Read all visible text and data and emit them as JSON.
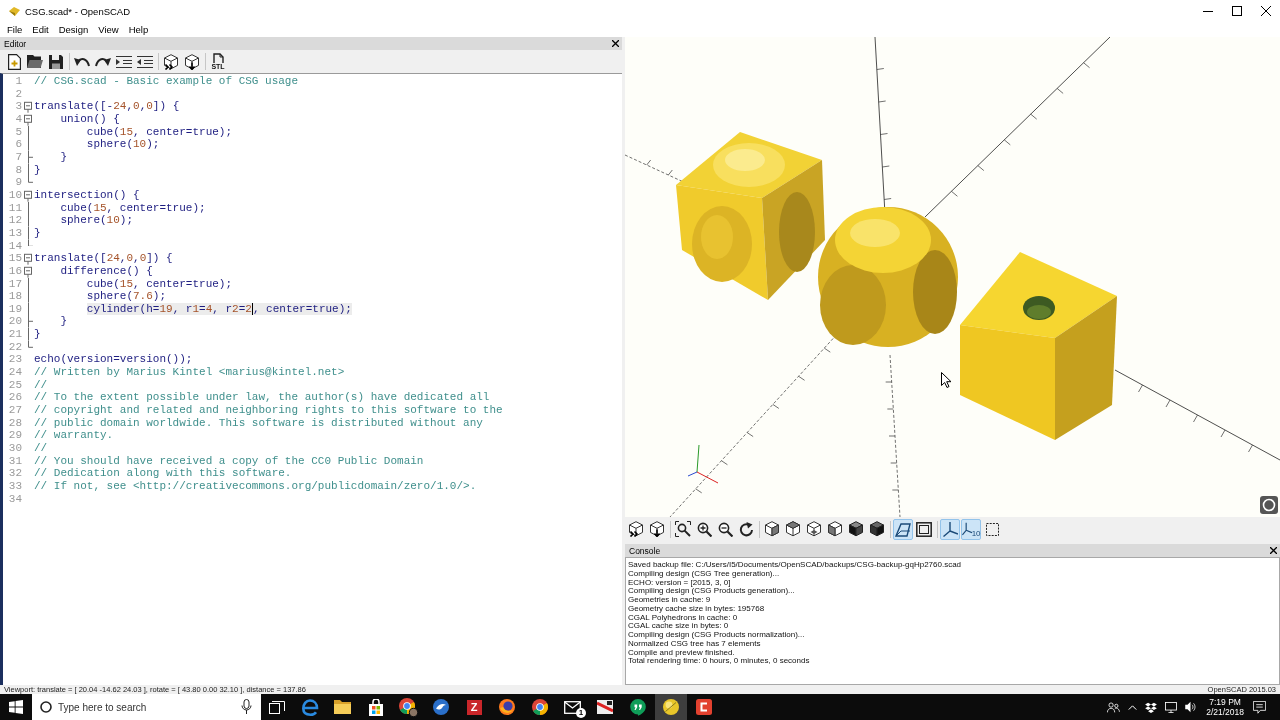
{
  "window": {
    "title": "CSG.scad* - OpenSCAD"
  },
  "menu": [
    "File",
    "Edit",
    "Design",
    "View",
    "Help"
  ],
  "editor": {
    "title": "Editor",
    "toolbar_groups": [
      [
        {
          "kind": "new"
        },
        {
          "kind": "open"
        },
        {
          "kind": "save"
        }
      ],
      [
        {
          "kind": "undo"
        },
        {
          "kind": "redo"
        },
        {
          "kind": "indent"
        },
        {
          "kind": "unindent"
        }
      ],
      [
        {
          "kind": "preview"
        },
        {
          "kind": "render"
        }
      ],
      [
        {
          "kind": "export-stl",
          "label": "STL"
        }
      ]
    ],
    "lines": [
      {
        "number": "1",
        "kind": "comment",
        "text": "// CSG.scad - Basic example of CSG usage",
        "selected": false
      },
      {
        "number": "2",
        "selected": false
      },
      {
        "number": "3",
        "kind": "code",
        "text": "translate([-24,0,0]) {",
        "fold": {
          "kind": "start"
        },
        "selected": false
      },
      {
        "number": "4",
        "kind": "code",
        "text": "    union() {",
        "fold": {
          "kind": "start"
        },
        "selected": false
      },
      {
        "number": "5",
        "kind": "code",
        "text": "        cube(15, center=true);",
        "fold": {
          "kind": "body"
        },
        "selected": false
      },
      {
        "number": "6",
        "kind": "code",
        "text": "        sphere(10);",
        "fold": {
          "kind": "body"
        },
        "selected": false
      },
      {
        "number": "7",
        "kind": "code",
        "text": "    }",
        "fold": {
          "kind": "branch"
        },
        "selected": false
      },
      {
        "number": "8",
        "kind": "code",
        "text": "}",
        "fold": {
          "kind": "body"
        },
        "selected": false
      },
      {
        "number": "9",
        "fold": {
          "kind": "end"
        },
        "selected": false
      },
      {
        "number": "10",
        "kind": "code",
        "text": "intersection() {",
        "fold": {
          "kind": "start"
        },
        "selected": false
      },
      {
        "number": "11",
        "kind": "code",
        "text": "    cube(15, center=true);",
        "fold": {
          "kind": "body"
        },
        "selected": false
      },
      {
        "number": "12",
        "kind": "code",
        "text": "    sphere(10);",
        "fold": {
          "kind": "body"
        },
        "selected": false
      },
      {
        "number": "13",
        "kind": "code",
        "text": "}",
        "fold": {
          "kind": "body"
        },
        "selected": false
      },
      {
        "number": "14",
        "fold": {
          "kind": "end"
        },
        "selected": false
      },
      {
        "number": "15",
        "kind": "code",
        "text": "translate([24,0,0]) {",
        "fold": {
          "kind": "start"
        },
        "selected": false
      },
      {
        "number": "16",
        "kind": "code",
        "text": "    difference() {",
        "fold": {
          "kind": "start"
        },
        "selected": false
      },
      {
        "number": "17",
        "kind": "code",
        "text": "        cube(15, center=true);",
        "fold": {
          "kind": "body"
        },
        "selected": false
      },
      {
        "number": "18",
        "kind": "code",
        "text": "        sphere(7.6);",
        "fold": {
          "kind": "body"
        },
        "selected": false
      },
      {
        "number": "19",
        "kind": "code",
        "text": "        cylinder(h=19, r1=4, r2=2",
        "after_caret": ", center=true);",
        "fold": {
          "kind": "body"
        },
        "selected": true
      },
      {
        "number": "20",
        "kind": "code",
        "text": "    }",
        "fold": {
          "kind": "branch"
        },
        "selected": false
      },
      {
        "number": "21",
        "kind": "code",
        "text": "}",
        "fold": {
          "kind": "body"
        },
        "selected": false
      },
      {
        "number": "22",
        "fold": {
          "kind": "end"
        },
        "selected": false
      },
      {
        "number": "23",
        "kind": "code",
        "text": "echo(version=version());",
        "selected": false
      },
      {
        "number": "24",
        "kind": "comment",
        "text": "// Written by Marius Kintel <marius@kintel.net>",
        "selected": false
      },
      {
        "number": "25",
        "kind": "comment",
        "text": "//",
        "selected": false
      },
      {
        "number": "26",
        "kind": "comment",
        "text": "// To the extent possible under law, the author(s) have dedicated all",
        "selected": false
      },
      {
        "number": "27",
        "kind": "comment",
        "text": "// copyright and related and neighboring rights to this software to the",
        "selected": false
      },
      {
        "number": "28",
        "kind": "comment",
        "text": "// public domain worldwide. This software is distributed without any",
        "selected": false
      },
      {
        "number": "29",
        "kind": "comment",
        "text": "// warranty.",
        "selected": false
      },
      {
        "number": "30",
        "kind": "comment",
        "text": "//",
        "selected": false
      },
      {
        "number": "31",
        "kind": "comment",
        "text": "// You should have received a copy of the CC0 Public Domain",
        "selected": false
      },
      {
        "number": "32",
        "kind": "comment",
        "text": "// Dedication along with this software.",
        "selected": false
      },
      {
        "number": "33",
        "kind": "comment",
        "text": "// If not, see <http://creativecommons.org/publicdomain/zero/1.0/>.",
        "selected": false
      },
      {
        "number": "34",
        "selected": false
      }
    ]
  },
  "viewport": {
    "toolbar_groups": [
      [
        {
          "kind": "preview",
          "on": false
        },
        {
          "kind": "render",
          "on": false
        }
      ],
      [
        {
          "kind": "view-all",
          "on": false
        },
        {
          "kind": "zoom-in",
          "on": false
        },
        {
          "kind": "zoom-out",
          "on": false
        },
        {
          "kind": "reset-view",
          "on": false
        }
      ],
      [
        {
          "kind": "view-right",
          "on": false
        },
        {
          "kind": "view-top",
          "on": false
        },
        {
          "kind": "view-bottom",
          "on": false
        },
        {
          "kind": "view-left",
          "on": false
        },
        {
          "kind": "view-front",
          "on": false
        },
        {
          "kind": "view-back",
          "on": false
        }
      ],
      [
        {
          "kind": "perspective",
          "on": true
        },
        {
          "kind": "orthogonal",
          "on": false
        }
      ],
      [
        {
          "kind": "axes",
          "on": true
        },
        {
          "kind": "scale-markers",
          "label": "10",
          "on": true
        },
        {
          "kind": "edges",
          "on": false
        }
      ]
    ]
  },
  "console": {
    "title": "Console",
    "lines": [
      "Saved backup file: C:/Users/I5/Documents/OpenSCAD/backups/CSG-backup-gqHp2760.scad",
      "Compiling design (CSG Tree generation)...",
      "ECHO: version = [2015, 3, 0]",
      "Compiling design (CSG Products generation)...",
      "Geometries in cache: 9",
      "Geometry cache size in bytes: 195768",
      "CGAL Polyhedrons in cache: 0",
      "CGAL cache size in bytes: 0",
      "Compiling design (CSG Products normalization)...",
      "Normalized CSG tree has 7 elements",
      "Compile and preview finished.",
      "Total rendering time: 0 hours, 0 minutes, 0 seconds"
    ]
  },
  "status_bar": {
    "viewport_info": "Viewport: translate = [ 20.04 -14.62 24.03 ], rotate = [ 43.80 0.00 32.10 ], distance = 137.86",
    "version": "OpenSCAD 2015.03"
  },
  "taskbar": {
    "search": {
      "placeholder": "Type here to search"
    },
    "apps": [
      {
        "kind": "task-view",
        "selected": false
      },
      {
        "kind": "e-browser",
        "selected": false
      },
      {
        "kind": "folder",
        "selected": false
      },
      {
        "kind": "store",
        "selected": false
      },
      {
        "kind": "ring-browser-profile",
        "selected": false
      },
      {
        "kind": "bird",
        "selected": false
      },
      {
        "kind": "letter-tile",
        "label": "Z",
        "selected": false
      },
      {
        "kind": "fox",
        "selected": false
      },
      {
        "kind": "ring-browser",
        "selected": false
      },
      {
        "kind": "mail",
        "badge": "1",
        "selected": false
      },
      {
        "kind": "tool",
        "selected": false
      },
      {
        "kind": "chat",
        "selected": false
      },
      {
        "kind": "cad",
        "selected": true
      },
      {
        "kind": "bracket-tile",
        "selected": false
      }
    ],
    "clock": {
      "time": "7:19 PM",
      "date": "2/21/2018"
    }
  }
}
